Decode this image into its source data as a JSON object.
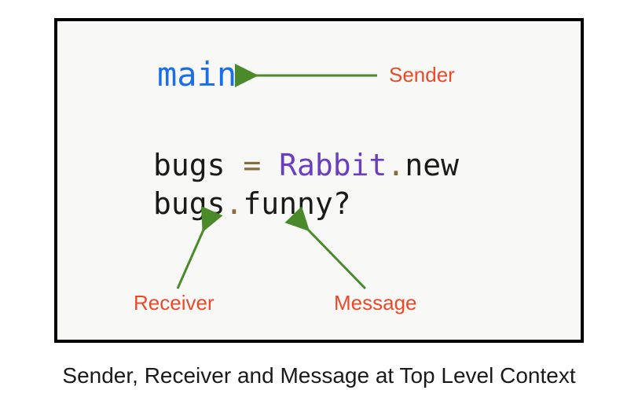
{
  "caption": "Sender, Receiver and Message at Top Level Context",
  "labels": {
    "main": "main",
    "sender": "Sender",
    "receiver": "Receiver",
    "message": "Message"
  },
  "code": {
    "line1": {
      "var": "bugs",
      "op": " = ",
      "class": "Rabbit",
      "dot": ".",
      "method": "new"
    },
    "line2": {
      "var": "bugs",
      "dot": ".",
      "method": "funny?"
    }
  },
  "colors": {
    "keyword_blue": "#1a6ee8",
    "class_purple": "#6a3fbf",
    "operator_brown": "#8a6b3a",
    "label_red": "#e84b2c",
    "arrow_green": "#4a8a2a"
  }
}
